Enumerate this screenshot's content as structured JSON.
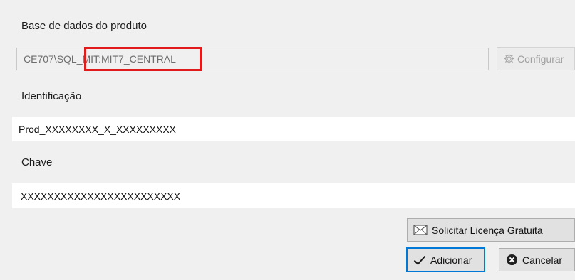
{
  "form": {
    "database_label": "Base de dados do produto",
    "database_value_prefix": "CE707\\SQL_",
    "database_value_highlight": "MIT:MIT7_CENTRAL",
    "configure_label": "Configurar",
    "identification_label": "Identificação",
    "identification_value": "Prod_XXXXXXXX_X_XXXXXXXXX",
    "key_label": "Chave",
    "key_value": "XXXXXXXXXXXXXXXXXXXXXXXX"
  },
  "buttons": {
    "request_license": "Solicitar Licença Gratuita",
    "add": "Adicionar",
    "cancel": "Cancelar"
  },
  "icons": {
    "configure": "gear-icon",
    "request_license": "envelope-icon",
    "add": "checkmark-icon",
    "cancel": "close-circle-icon"
  },
  "colors": {
    "highlight": "#e01b1b",
    "default_button_border": "#0078d7"
  }
}
